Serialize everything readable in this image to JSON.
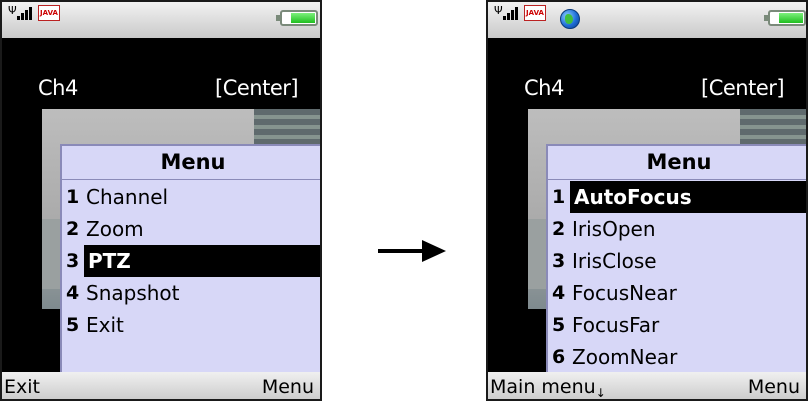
{
  "screens": [
    {
      "channel": "Ch4",
      "position": "[Center]",
      "status_icons": [
        "signal-icon",
        "java-icon",
        "battery-icon"
      ],
      "java_text": "JAVA",
      "menu": {
        "title": "Menu",
        "items": [
          {
            "num": "1",
            "label": "Channel"
          },
          {
            "num": "2",
            "label": "Zoom"
          },
          {
            "num": "3",
            "label": "PTZ",
            "selected": true
          },
          {
            "num": "4",
            "label": "Snapshot"
          },
          {
            "num": "5",
            "label": "Exit"
          }
        ]
      },
      "softkeys": {
        "left": "Exit",
        "right": "Menu"
      }
    },
    {
      "channel": "Ch4",
      "position": "[Center]",
      "status_icons": [
        "signal-icon",
        "java-icon",
        "globe-icon",
        "battery-icon"
      ],
      "java_text": "JAVA",
      "menu": {
        "title": "Menu",
        "items": [
          {
            "num": "1",
            "label": "AutoFocus",
            "selected": true
          },
          {
            "num": "2",
            "label": "IrisOpen"
          },
          {
            "num": "3",
            "label": "IrisClose"
          },
          {
            "num": "4",
            "label": "FocusNear"
          },
          {
            "num": "5",
            "label": "FocusFar"
          },
          {
            "num": "6",
            "label": "ZoomNear"
          }
        ]
      },
      "softkeys": {
        "left": "Main menu",
        "right": "Menu"
      }
    }
  ],
  "colors": {
    "menu_background": "#d7d7f7",
    "selection_background": "#000000",
    "screen_background": "#000000"
  },
  "transition_icon": "right-arrow-icon"
}
